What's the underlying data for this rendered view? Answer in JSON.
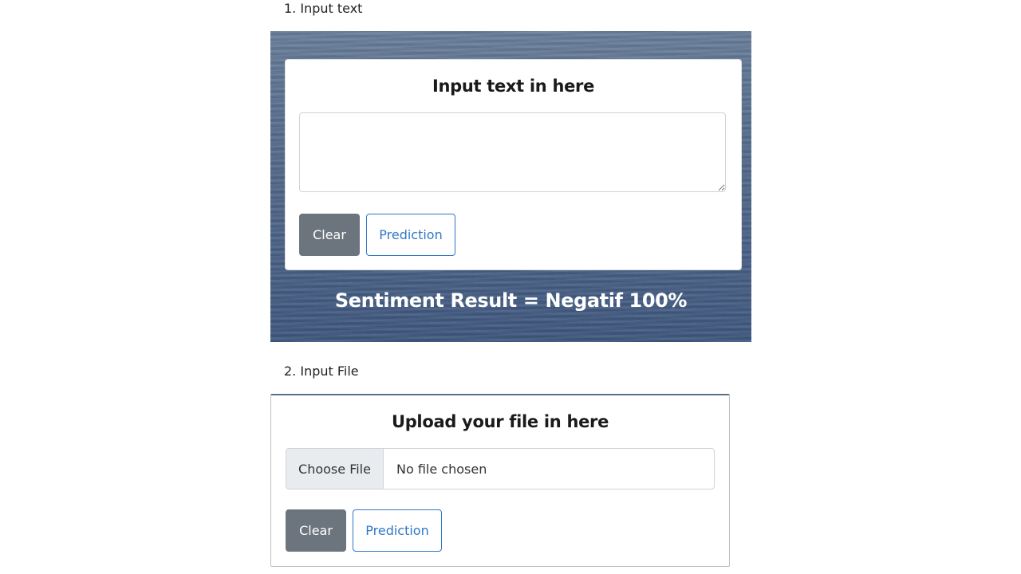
{
  "section1": {
    "label": "1. Input text",
    "card_title": "Input text in here",
    "textarea_value": "",
    "clear_label": "Clear",
    "predict_label": "Prediction",
    "result_text": "Sentiment Result = Negatif 100%"
  },
  "section2": {
    "label": "2. Input File",
    "card_title": "Upload your file in here",
    "choose_label": "Choose File",
    "file_status": "No file chosen",
    "clear_label": "Clear",
    "predict_label": "Prediction"
  },
  "colors": {
    "clear_button": "#6c757d",
    "predict_button_border": "#3178c6",
    "result_text": "#ffffff"
  }
}
